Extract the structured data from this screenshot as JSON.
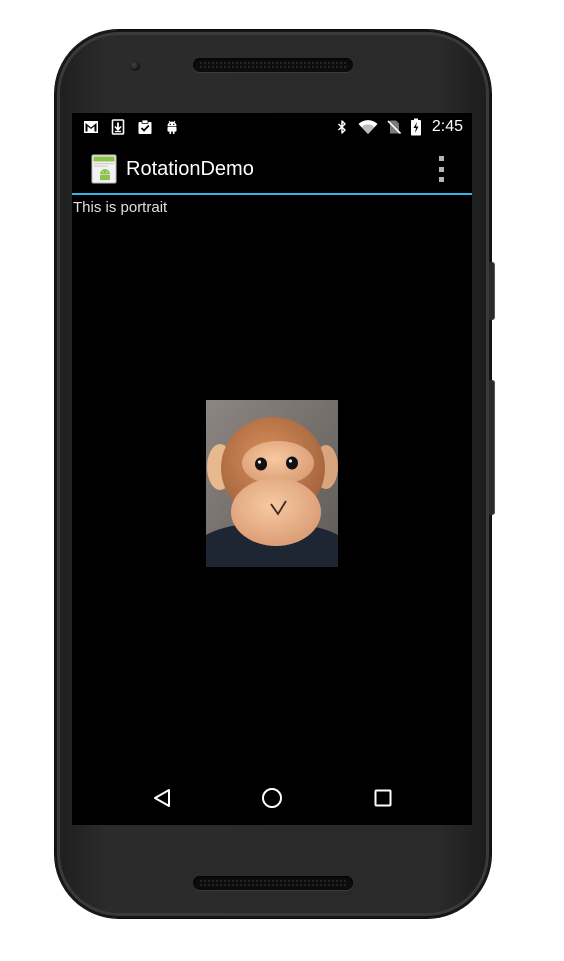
{
  "status_bar": {
    "time": "2:45",
    "left_icons": [
      "gmail-icon",
      "download-icon",
      "clipboard-check-icon",
      "android-debug-icon"
    ],
    "right_icons": [
      "bluetooth-icon",
      "wifi-icon",
      "no-sim-icon",
      "battery-charging-icon"
    ]
  },
  "action_bar": {
    "title": "RotationDemo",
    "app_icon": "app-launcher-icon",
    "overflow_icon": "overflow-menu-icon"
  },
  "content": {
    "orientation_text": "This is portrait",
    "photo": "monkey-photo"
  },
  "nav_bar": {
    "back_icon": "back-icon",
    "home_icon": "home-icon",
    "recents_icon": "recents-icon"
  },
  "colors": {
    "accent": "#33b5e5",
    "background": "#000000",
    "text": "#ffffff"
  }
}
